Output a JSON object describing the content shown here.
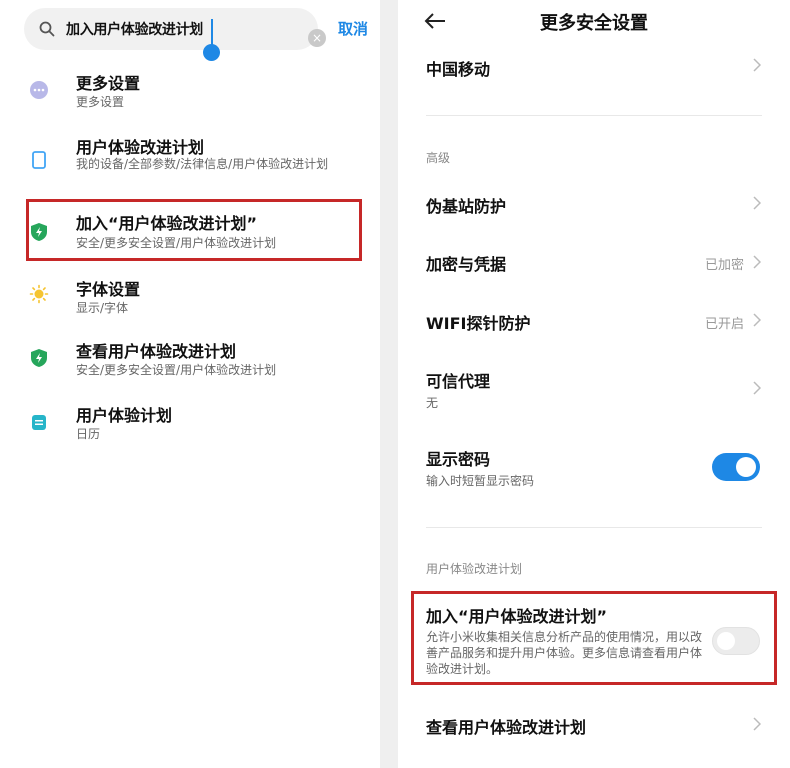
{
  "search": {
    "query": "加入用户体验改进计划",
    "clear_glyph": "×",
    "cancel_label": "取消"
  },
  "results": [
    {
      "title": "更多设置",
      "path": "更多设置",
      "icon": "more-dots-icon",
      "color": "#b8b8e8"
    },
    {
      "title": "用户体验改进计划",
      "path": "我的设备/全部参数/法律信息/用户体验改进计划",
      "icon": "phone-icon",
      "color": "#42a5f5"
    },
    {
      "title": "加入“用户体验改进计划”",
      "path": "安全/更多安全设置/用户体验改进计划",
      "icon": "shield-icon",
      "color": "#26a65b"
    },
    {
      "title": "字体设置",
      "path": "显示/字体",
      "icon": "sun-icon",
      "color": "#f5c431"
    },
    {
      "title": "查看用户体验改进计划",
      "path": "安全/更多安全设置/用户体验改进计划",
      "icon": "shield-icon",
      "color": "#26a65b"
    },
    {
      "title": "用户体验计划",
      "path": "日历",
      "icon": "calendar-icon",
      "color": "#26b5c9"
    }
  ],
  "settings": {
    "title": "更多安全设置",
    "carrier": "中国移动",
    "section_advanced": "高级",
    "fake_base_station": "伪基站防护",
    "encryption": "加密与凭据",
    "encryption_status": "已加密",
    "wifi_probe": "WIFI探针防护",
    "wifi_probe_status": "已开启",
    "trust_agent": "可信代理",
    "trust_agent_value": "无",
    "show_password": "显示密码",
    "show_password_desc": "输入时短暂显示密码",
    "show_password_on": true,
    "section_ux": "用户体验改进计划",
    "join_ux": "加入“用户体验改进计划”",
    "join_ux_desc": "允许小米收集相关信息分析产品的使用情况，用以改善产品服务和提升用户体验。更多信息请查看用户体验改进计划。",
    "join_ux_on": false,
    "view_ux": "查看用户体验改进计划"
  },
  "colors": {
    "accent": "#1e88e5",
    "highlight": "#c62828"
  }
}
